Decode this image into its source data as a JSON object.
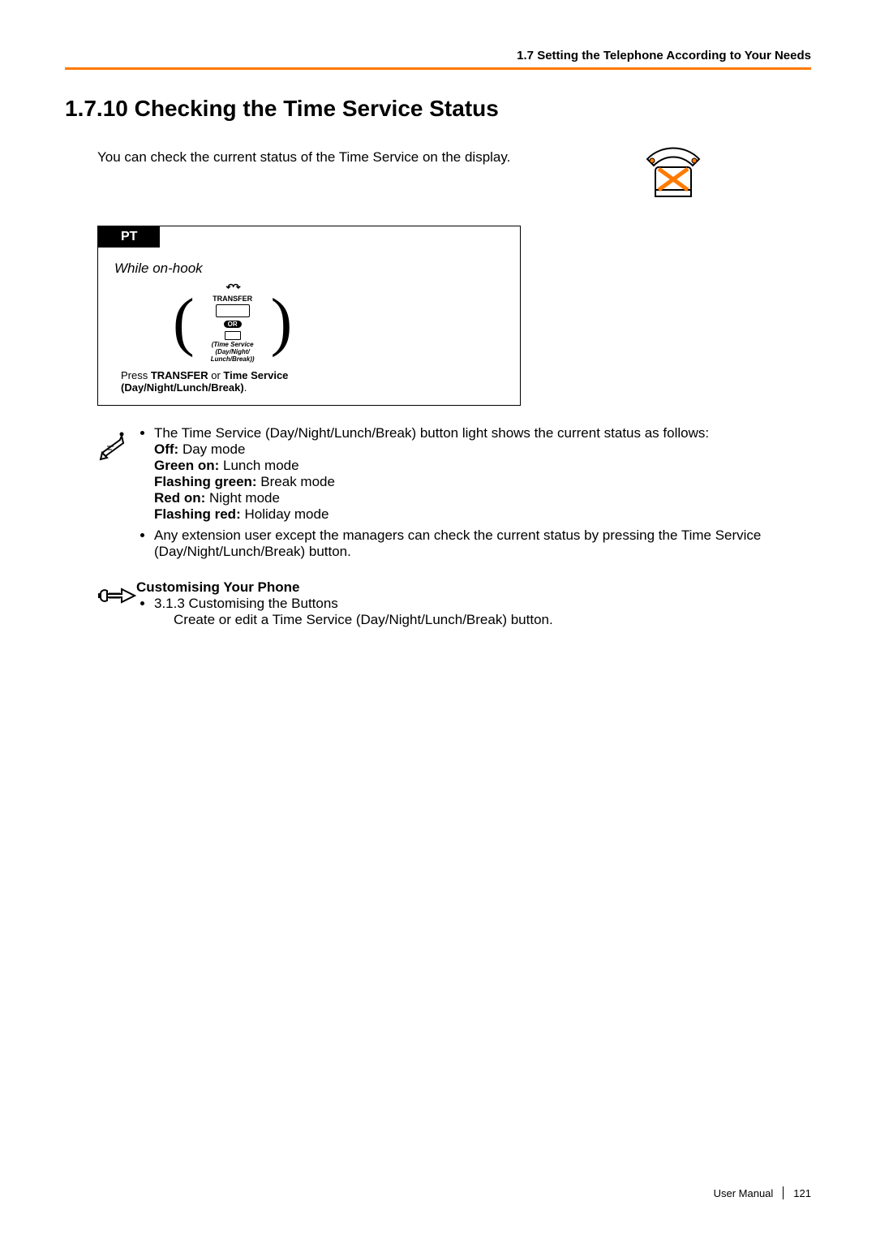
{
  "header": "1.7 Setting the Telephone According to Your Needs",
  "section_title": "1.7.10   Checking the Time Service Status",
  "intro": "You can check the current status of the Time Service on the display.",
  "pt": {
    "tab": "PT",
    "subtitle": "While on-hook",
    "transfer_label": "TRANSFER",
    "or_label": "OR",
    "ts_line1": "(Time Service",
    "ts_line2": "(Day/Night/",
    "ts_line3": "Lunch/Break))",
    "instruction_press": "Press ",
    "instruction_bold1": "TRANSFER",
    "instruction_or": " or ",
    "instruction_bold2": "Time Service",
    "instruction_bold3": "(Day/Night/Lunch/Break)",
    "instruction_period": "."
  },
  "notes1": {
    "lead": "The Time Service (Day/Night/Lunch/Break) button light shows the current status as follows:",
    "off_label": "Off:",
    "off_val": " Day mode",
    "green_label": "Green on:",
    "green_val": " Lunch mode",
    "flash_green_label": "Flashing green:",
    "flash_green_val": " Break mode",
    "red_label": "Red on:",
    "red_val": " Night mode",
    "flash_red_label": "Flashing red:",
    "flash_red_val": " Holiday mode",
    "bullet2": "Any extension user except the managers can check the current status by pressing the Time Service (Day/Night/Lunch/Break) button."
  },
  "customising": {
    "heading": "Customising Your Phone",
    "ref": "3.1.3 Customising the Buttons",
    "detail": "Create or edit a Time Service (Day/Night/Lunch/Break) button."
  },
  "footer": {
    "label": "User Manual",
    "page": "121"
  }
}
